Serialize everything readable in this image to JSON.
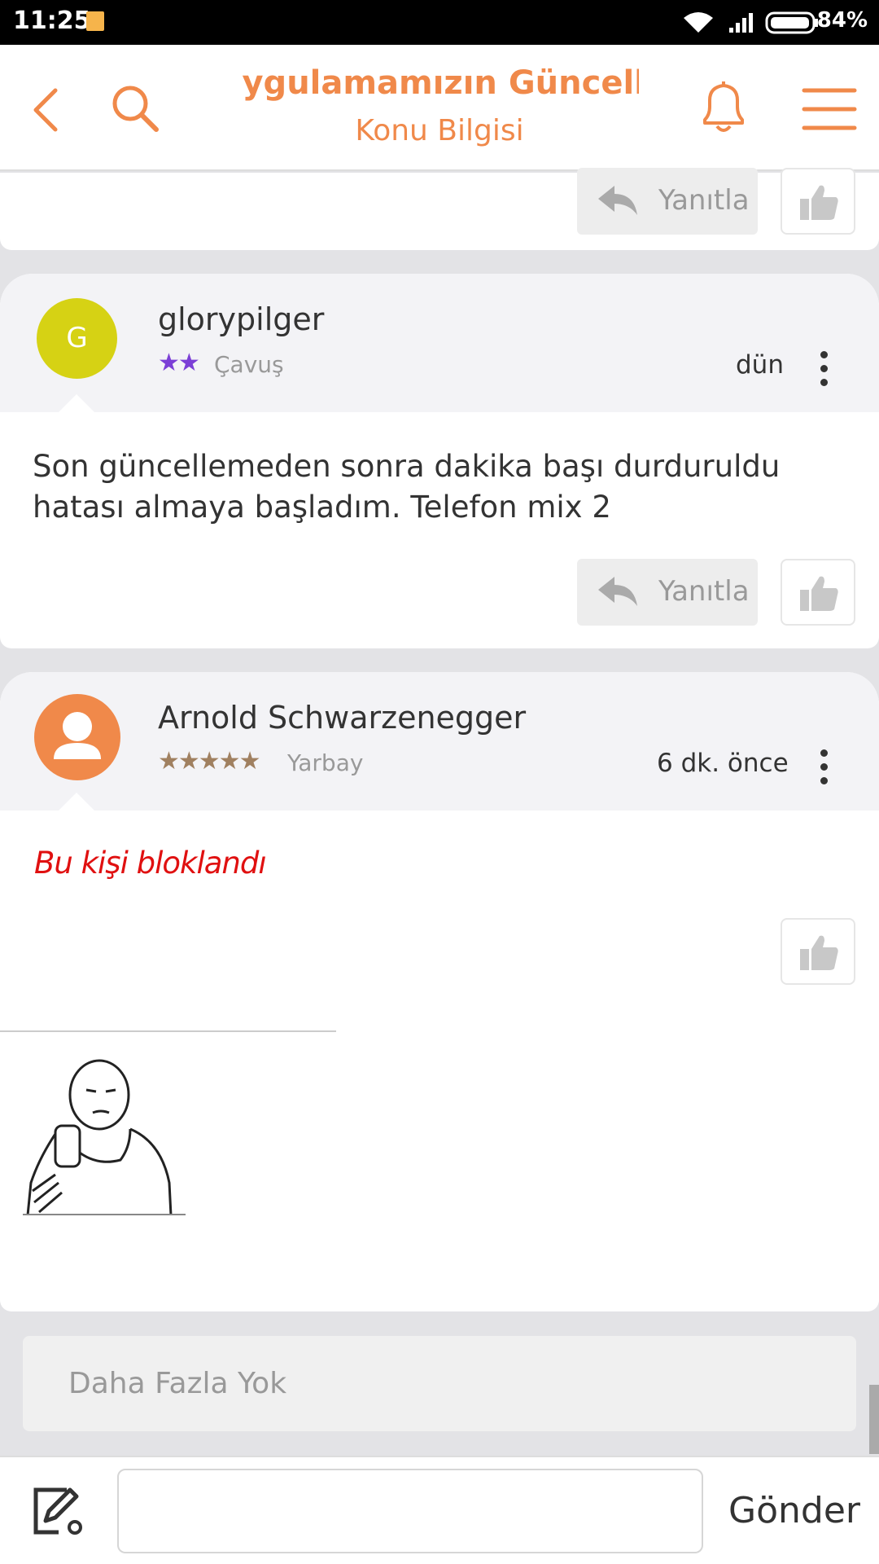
{
  "status_bar": {
    "time": "11:25",
    "battery": "84%"
  },
  "header": {
    "title": "Uygulamamızın Güncelleme Geri Bildirimleri",
    "subtitle": "Konu Bilgisi"
  },
  "prev_card": {
    "reply_label": "Yanıtla"
  },
  "posts": [
    {
      "avatar_letter": "G",
      "username": "glorypilger",
      "rank": "Çavuş",
      "stars": 2,
      "time": "dün",
      "content": "Son güncellemeden sonra dakika başı durduruldu hatası almaya başladım. Telefon mix 2",
      "reply_label": "Yanıtla"
    },
    {
      "username": "Arnold Schwarzenegger",
      "rank": "Yarbay",
      "stars": 5,
      "time": "6 dk. önce",
      "blocked_text": "Bu kişi bloklandı"
    }
  ],
  "footer": {
    "no_more": "Daha Fazla Yok",
    "send": "Gönder",
    "input_placeholder": ""
  },
  "colors": {
    "accent": "#f0894a",
    "star_purple": "#7b3fd6",
    "star_brown": "#a08060",
    "blocked": "#e01010"
  }
}
